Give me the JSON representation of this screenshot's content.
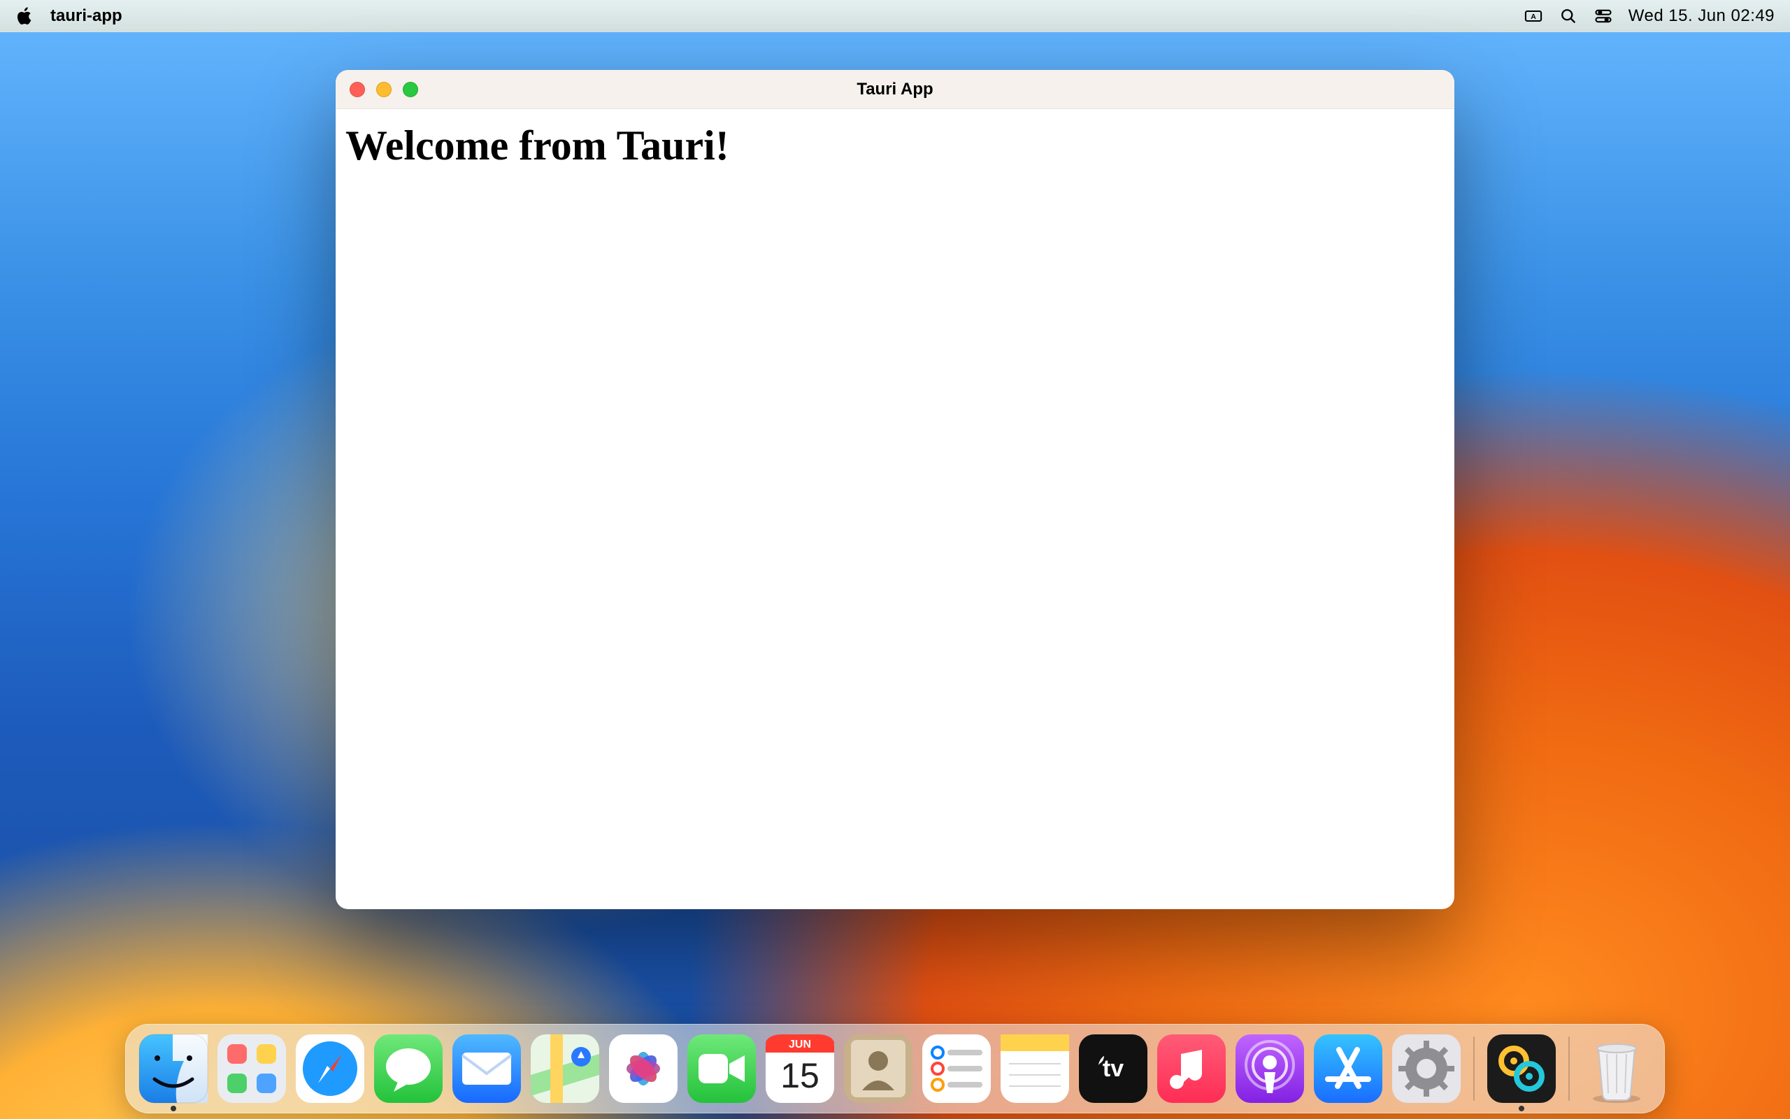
{
  "menubar": {
    "app_name": "tauri-app",
    "date_time": "Wed 15. Jun  02:49"
  },
  "window": {
    "title": "Tauri App",
    "heading": "Welcome from Tauri!"
  },
  "dock": {
    "items": [
      {
        "name": "finder"
      },
      {
        "name": "launchpad"
      },
      {
        "name": "safari"
      },
      {
        "name": "messages"
      },
      {
        "name": "mail"
      },
      {
        "name": "maps"
      },
      {
        "name": "photos"
      },
      {
        "name": "facetime"
      },
      {
        "name": "calendar",
        "month": "JUN",
        "day": "15"
      },
      {
        "name": "contacts"
      },
      {
        "name": "reminders"
      },
      {
        "name": "notes"
      },
      {
        "name": "tv"
      },
      {
        "name": "music"
      },
      {
        "name": "podcasts"
      },
      {
        "name": "appstore"
      },
      {
        "name": "system-settings"
      }
    ],
    "pinned": [
      {
        "name": "tauri"
      }
    ],
    "trash": {
      "name": "trash"
    }
  }
}
